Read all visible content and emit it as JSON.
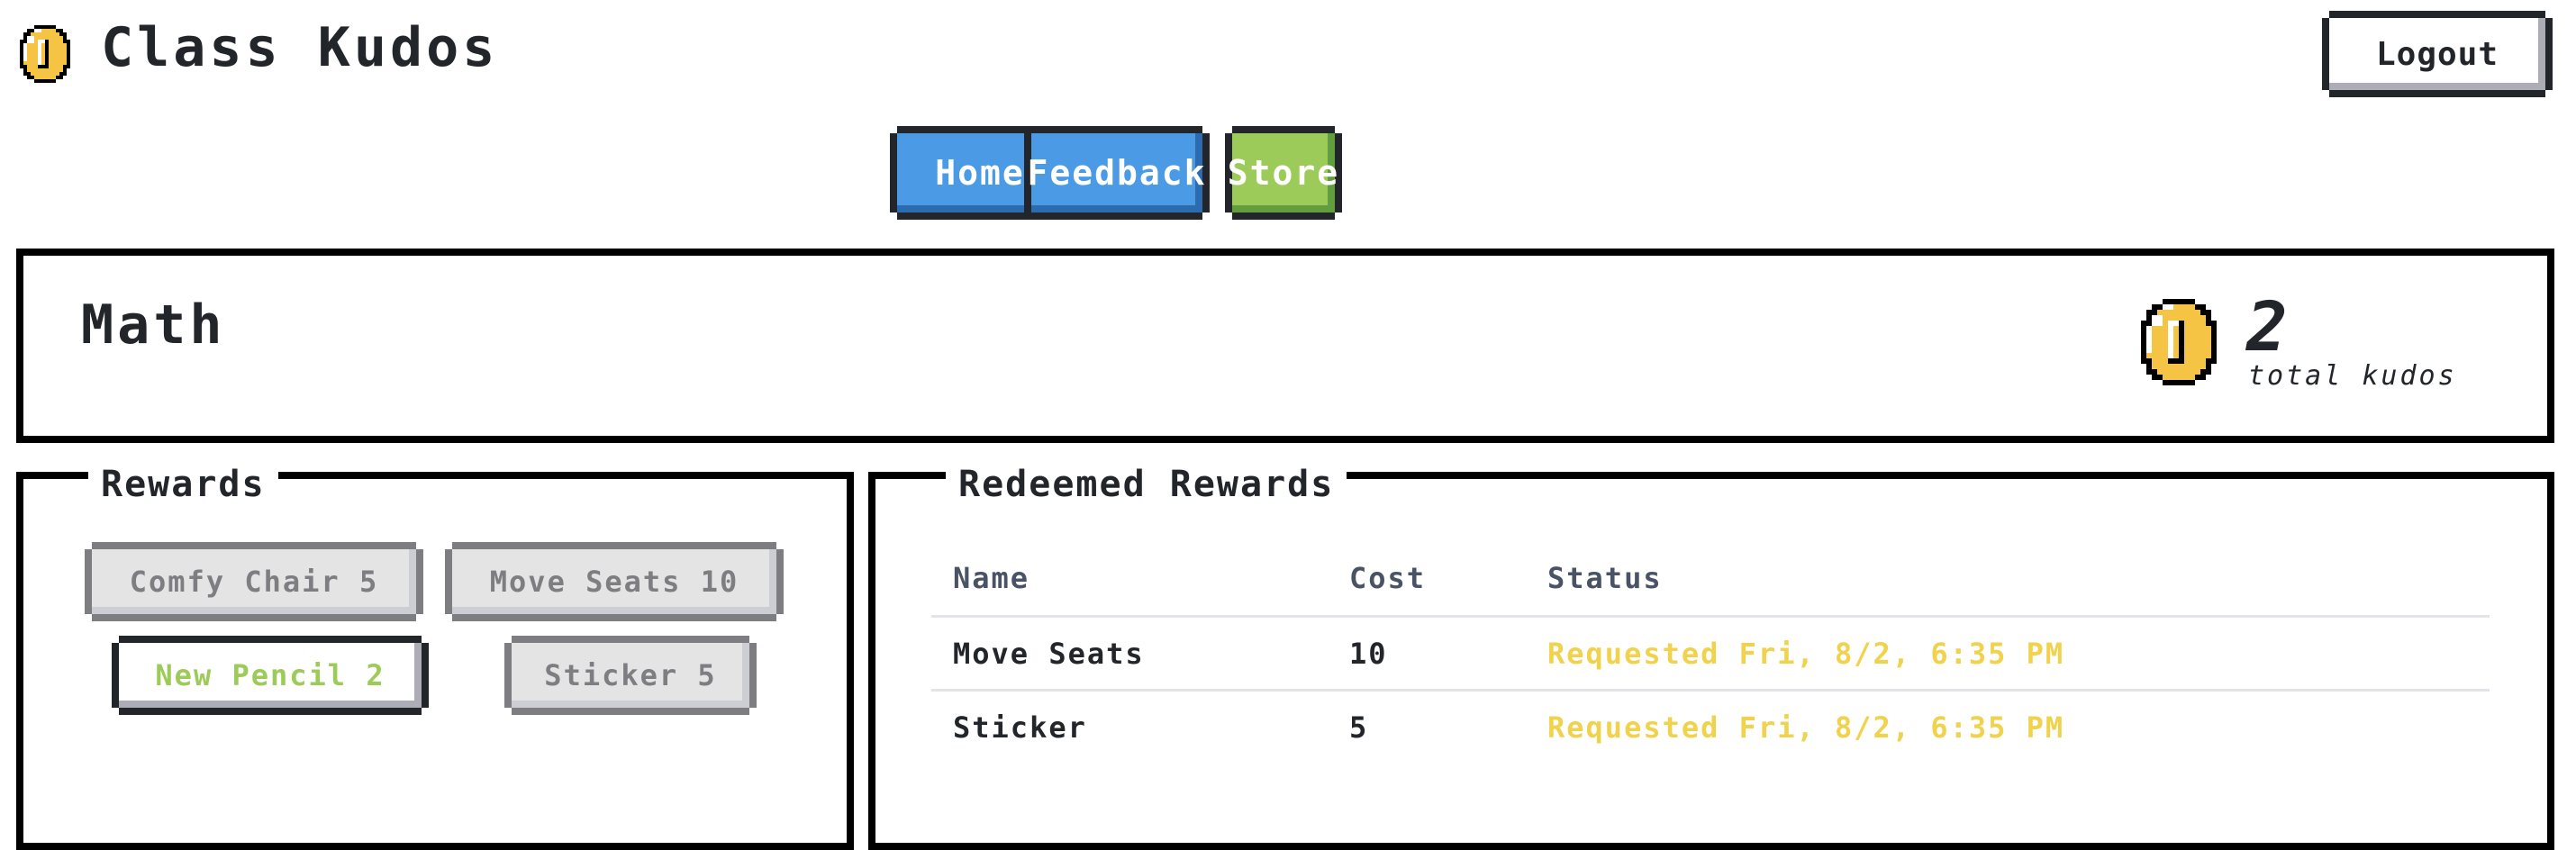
{
  "header": {
    "app_title": "Class Kudos",
    "logo_icon": "coin-icon",
    "logout_label": "Logout"
  },
  "nav": {
    "items": [
      {
        "label": "Home",
        "color": "#4a9ae6"
      },
      {
        "label": "Feedback",
        "color": "#4a9ae6"
      },
      {
        "label": "Store",
        "color": "#9ccb5a",
        "active": true
      }
    ]
  },
  "class_info": {
    "class_name": "Math",
    "kudos_total": "2",
    "kudos_label": "total kudos",
    "kudos_icon": "coin-icon"
  },
  "rewards": {
    "title": "Rewards",
    "items": [
      {
        "label": "Comfy Chair 5",
        "name": "Comfy Chair",
        "cost": 5,
        "state": "disabled"
      },
      {
        "label": "Move Seats 10",
        "name": "Move Seats",
        "cost": 10,
        "state": "disabled"
      },
      {
        "label": "New Pencil 2",
        "name": "New Pencil",
        "cost": 2,
        "state": "available"
      },
      {
        "label": "Sticker 5",
        "name": "Sticker",
        "cost": 5,
        "state": "disabled"
      }
    ]
  },
  "redeemed": {
    "title": "Redeemed Rewards",
    "columns": [
      "Name",
      "Cost",
      "Status"
    ],
    "rows": [
      {
        "name": "Move Seats",
        "cost": "10",
        "status": "Requested Fri, 8/2, 6:35 PM"
      },
      {
        "name": "Sticker",
        "cost": "5",
        "status": "Requested Fri, 8/2, 6:35 PM"
      }
    ]
  },
  "colors": {
    "primary_blue": "#4a9ae6",
    "store_green": "#9ccb5a",
    "coin_gold": "#f5c445",
    "status_requested": "#f0d24c",
    "text_dark": "#222529"
  }
}
